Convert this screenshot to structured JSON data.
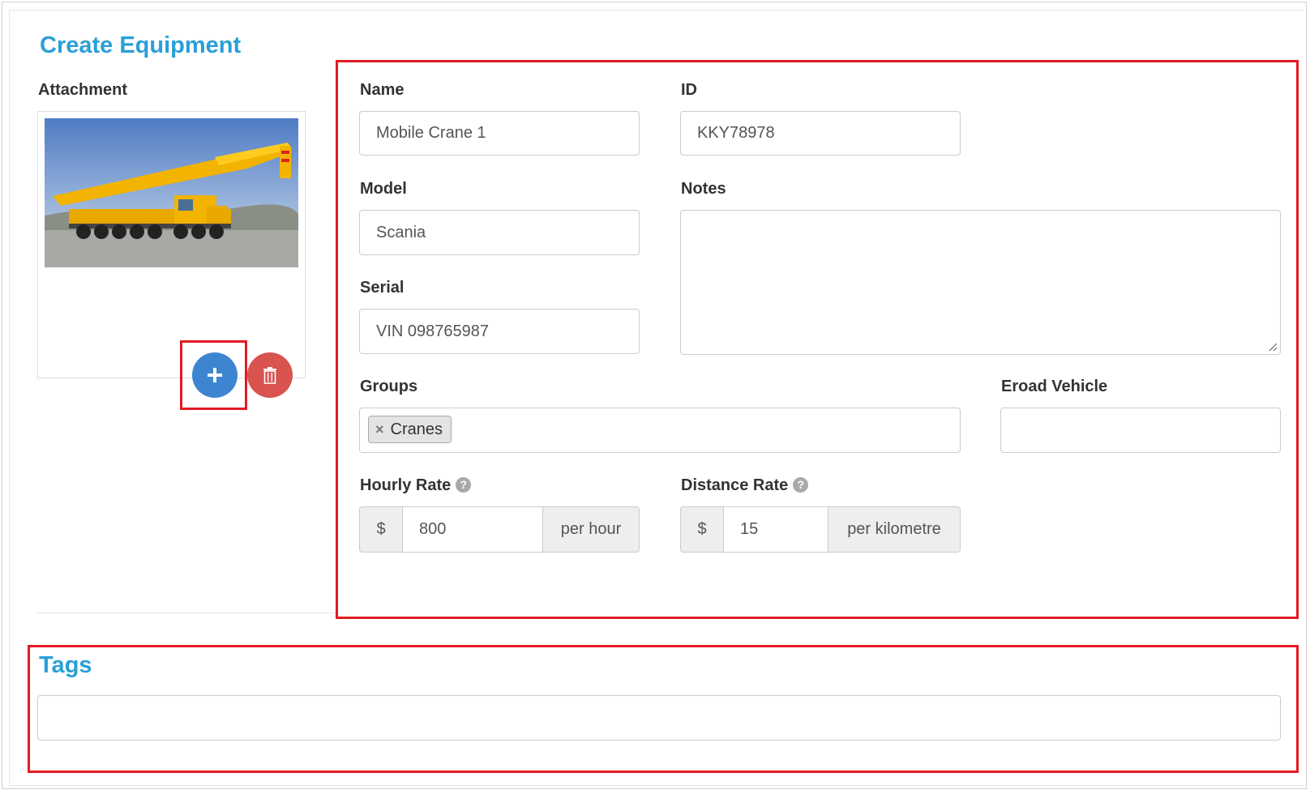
{
  "page": {
    "title": "Create Equipment"
  },
  "attachment": {
    "label": "Attachment",
    "image_alt": "mobile crane photo",
    "add_icon": "plus-icon",
    "delete_icon": "trash-icon"
  },
  "form": {
    "name": {
      "label": "Name",
      "value": "Mobile Crane 1"
    },
    "id": {
      "label": "ID",
      "value": "KKY78978"
    },
    "model": {
      "label": "Model",
      "value": "Scania"
    },
    "notes": {
      "label": "Notes",
      "value": ""
    },
    "serial": {
      "label": "Serial",
      "value": "VIN 098765987"
    },
    "groups": {
      "label": "Groups",
      "selected": [
        "Cranes"
      ],
      "remove_glyph": "×"
    },
    "eroad_vehicle": {
      "label": "Eroad Vehicle",
      "value": ""
    },
    "hourly_rate": {
      "label": "Hourly Rate",
      "prefix": "$",
      "value": "800",
      "suffix": "per hour",
      "help_glyph": "?"
    },
    "distance_rate": {
      "label": "Distance Rate",
      "prefix": "$",
      "value": "15",
      "suffix": "per kilometre",
      "help_glyph": "?"
    }
  },
  "tags": {
    "title": "Tags",
    "value": ""
  },
  "colors": {
    "heading": "#2a9fd8",
    "add_button": "#3d85d0",
    "delete_button": "#d9534f",
    "highlight": "#e31b23"
  }
}
